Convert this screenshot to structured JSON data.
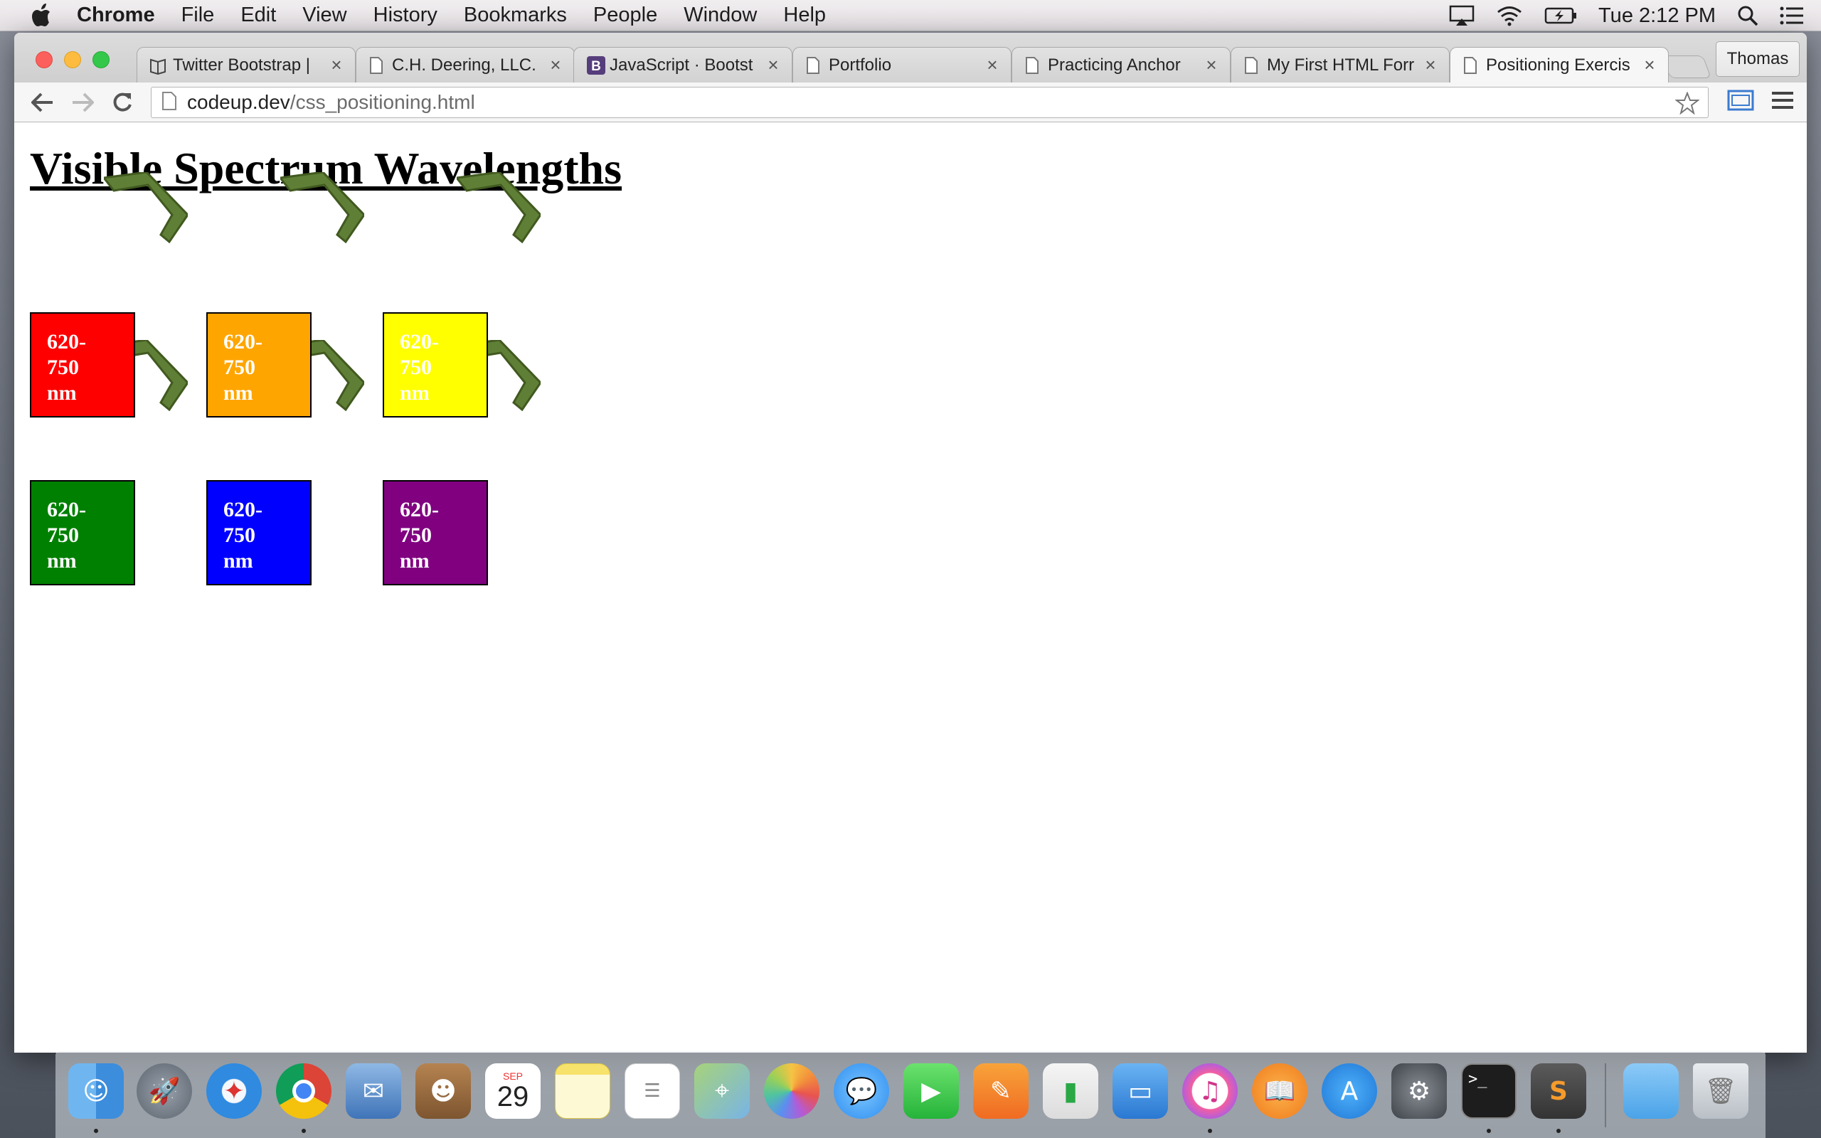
{
  "menubar": {
    "items": [
      "Chrome",
      "File",
      "Edit",
      "View",
      "History",
      "Bookmarks",
      "People",
      "Window",
      "Help"
    ],
    "clock": "Tue 2:12 PM"
  },
  "browser": {
    "tabs": [
      {
        "title": "Twitter Bootstrap |",
        "favicon": "book-icon"
      },
      {
        "title": "C.H. Deering, LLC.",
        "favicon": "page-icon"
      },
      {
        "title": "JavaScript · Bootst",
        "favicon": "bootstrap-b-icon"
      },
      {
        "title": "Portfolio",
        "favicon": "page-icon"
      },
      {
        "title": "Practicing Anchor",
        "favicon": "page-icon"
      },
      {
        "title": "My First HTML Forr",
        "favicon": "page-icon"
      },
      {
        "title": "Positioning Exercis",
        "favicon": "page-icon",
        "active": true
      }
    ],
    "profile_name": "Thomas",
    "url_host": "codeup.dev",
    "url_path": "/css_positioning.html"
  },
  "page": {
    "heading": "Visible Spectrum Wavelengths",
    "boxes": [
      {
        "line1": "620-",
        "line2": "750",
        "line3": "nm",
        "color": "#ff0000"
      },
      {
        "line1": "620-",
        "line2": "750",
        "line3": "nm",
        "color": "#ffa500"
      },
      {
        "line1": "620-",
        "line2": "750",
        "line3": "nm",
        "color": "#ffff00"
      },
      {
        "line1": "620-",
        "line2": "750",
        "line3": "nm",
        "color": "#008000"
      },
      {
        "line1": "620-",
        "line2": "750",
        "line3": "nm",
        "color": "#0000ff"
      },
      {
        "line1": "620-",
        "line2": "750",
        "line3": "nm",
        "color": "#800080"
      }
    ],
    "chevron_color": "#5f7f37"
  },
  "dock": {
    "apps": [
      "Finder",
      "Launchpad",
      "Safari",
      "Chrome",
      "Mail",
      "Contacts",
      "Calendar",
      "Notes",
      "Reminders",
      "Maps",
      "Photos",
      "Messages",
      "FaceTime",
      "Pages",
      "Numbers",
      "Keynote",
      "iTunes",
      "iBooks",
      "App Store",
      "System Preferences",
      "Terminal",
      "Sublime Text",
      "Downloads",
      "Trash"
    ],
    "calendar_month": "SEP",
    "calendar_day": "29"
  }
}
